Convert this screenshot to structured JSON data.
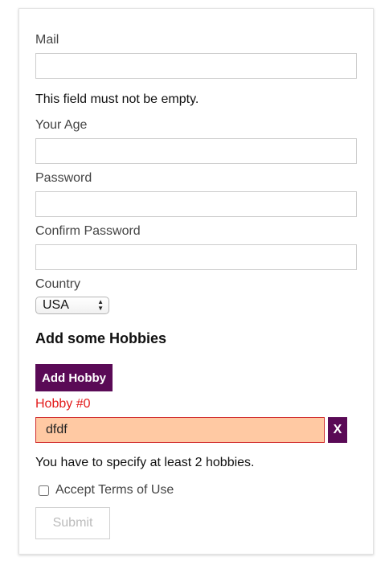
{
  "form": {
    "mail": {
      "label": "Mail",
      "value": "",
      "error": "This field must not be empty."
    },
    "age": {
      "label": "Your Age",
      "value": ""
    },
    "password": {
      "label": "Password",
      "value": ""
    },
    "confirm_password": {
      "label": "Confirm Password",
      "value": ""
    },
    "country": {
      "label": "Country",
      "selected": "USA"
    },
    "hobbies": {
      "heading": "Add some Hobbies",
      "add_button": "Add Hobby",
      "items": [
        {
          "label": "Hobby #0",
          "value": "dfdf",
          "remove_label": "X"
        }
      ],
      "error": "You have to specify at least 2 hobbies."
    },
    "terms": {
      "label": "Accept Terms of Use",
      "checked": false
    },
    "submit_label": "Submit"
  },
  "colors": {
    "accent": "#5a0a56",
    "error_text": "#e21b1b",
    "error_field_bg": "#ffc9a3",
    "error_field_border": "#d12b2b"
  }
}
